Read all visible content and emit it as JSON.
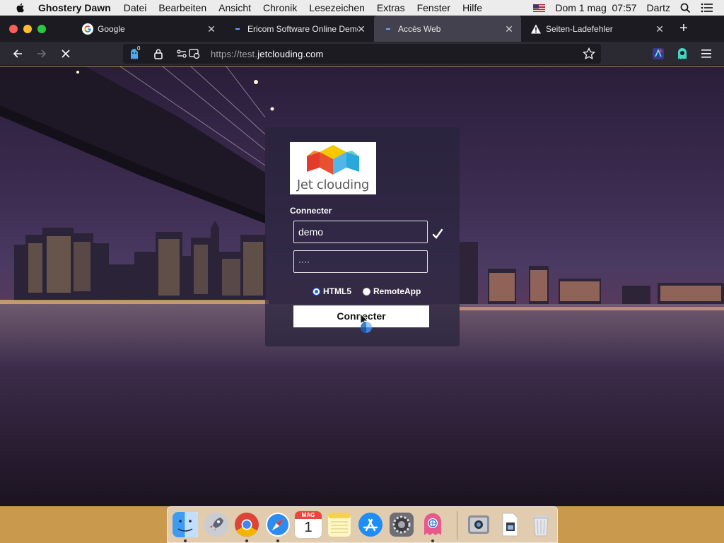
{
  "menubar": {
    "app_name": "Ghostery Dawn",
    "items": [
      "Datei",
      "Bearbeiten",
      "Ansicht",
      "Chronik",
      "Lesezeichen",
      "Extras",
      "Fenster",
      "Hilfe"
    ],
    "datetime": "Dom 1 mag  07:57",
    "user": "Dartz"
  },
  "tabs": [
    {
      "label": "Google",
      "icon": "google-icon"
    },
    {
      "label": "Ericom Software Online Demo",
      "icon": "blue-dash-icon"
    },
    {
      "label": "Accès Web",
      "icon": "blue-dash-icon",
      "active": true
    },
    {
      "label": "Seiten-Ladefehler",
      "icon": "warning-icon"
    }
  ],
  "toolbar": {
    "ghostery_badge": "0",
    "url_prefix": "https://test.",
    "url_domain": "jetclouding.com"
  },
  "login": {
    "logo_text": "Jet clouding",
    "title": "Connecter",
    "username": "demo",
    "password": "····",
    "radio_html5": "HTML5",
    "radio_remoteapp": "RemoteApp",
    "connect_label": "Connecter"
  },
  "dock": {
    "calendar_month": "MAG",
    "calendar_day": "1"
  },
  "colors": {
    "tabbar_bg": "#1c1b22",
    "active_tab_bg": "#42414d",
    "navbar_bg": "#2b2a33",
    "panel_bg": "rgba(40,36,60,0.72)"
  }
}
